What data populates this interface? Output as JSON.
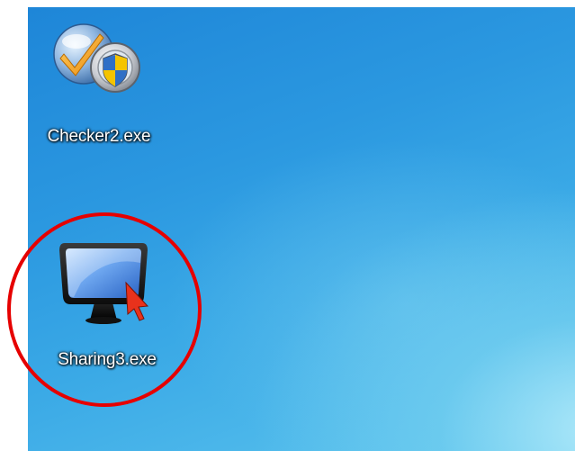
{
  "desktop": {
    "icons": [
      {
        "label": "Checker2.exe",
        "icon": "checker-shield-icon"
      },
      {
        "label": "Sharing3.exe",
        "icon": "monitor-cursor-icon"
      }
    ]
  },
  "annotation": {
    "type": "circle-highlight",
    "color": "#e60000",
    "target": "Sharing3.exe"
  }
}
